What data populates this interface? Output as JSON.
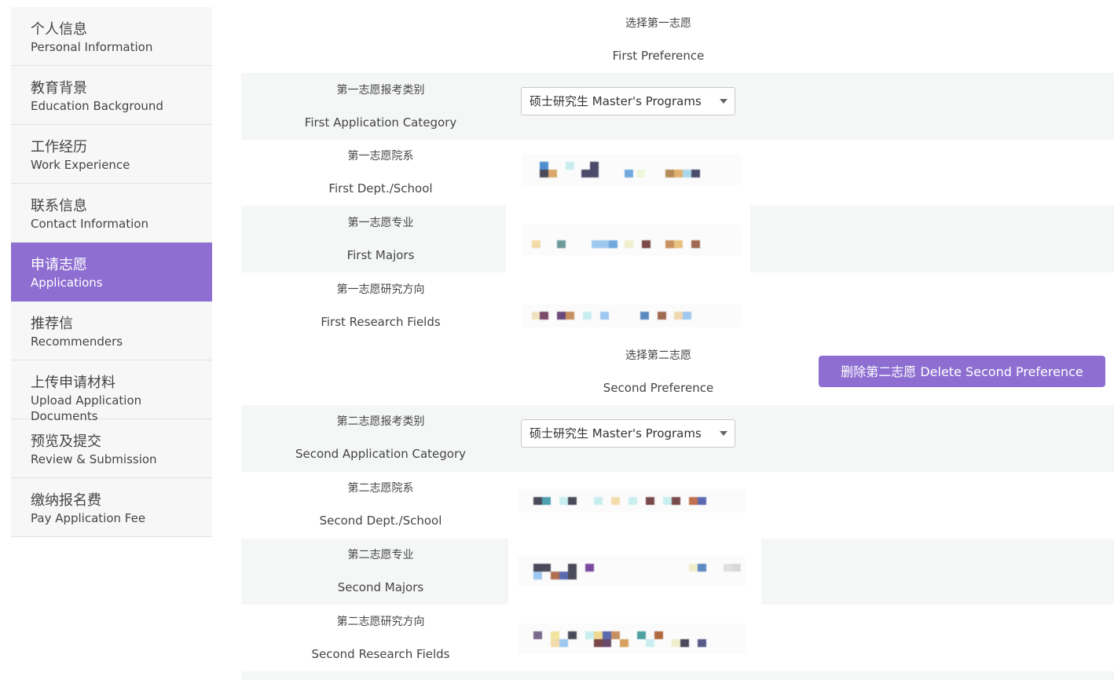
{
  "sidebar": {
    "items": [
      {
        "zh": "个人信息",
        "en": "Personal Information"
      },
      {
        "zh": "教育背景",
        "en": "Education Background"
      },
      {
        "zh": "工作经历",
        "en": "Work Experience"
      },
      {
        "zh": "联系信息",
        "en": "Contact Information"
      },
      {
        "zh": "申请志愿",
        "en": "Applications"
      },
      {
        "zh": "推荐信",
        "en": "Recommenders"
      },
      {
        "zh": "上传申请材料",
        "en": "Upload Application Documents"
      },
      {
        "zh": "预览及提交",
        "en": "Review & Submission"
      },
      {
        "zh": "缴纳报名费",
        "en": "Pay Application Fee"
      }
    ],
    "active_index": 4
  },
  "first": {
    "heading_zh": "选择第一志愿",
    "heading_en": "First Preference",
    "category_zh": "第一志愿报考类别",
    "category_en": "First Application Category",
    "category_value": "硕士研究生 Master's Programs",
    "dept_zh": "第一志愿院系",
    "dept_en": "First Dept./School",
    "major_zh": "第一志愿专业",
    "major_en": "First Majors",
    "field_zh": "第一志愿研究方向",
    "field_en": "First Research Fields"
  },
  "second": {
    "heading_zh": "选择第二志愿",
    "heading_en": "Second Preference",
    "delete_label": "删除第二志愿 Delete Second Preference",
    "category_zh": "第二志愿报考类别",
    "category_en": "Second Application Category",
    "category_value": "硕士研究生 Master's Programs",
    "dept_zh": "第二志愿院系",
    "dept_en": "Second Dept./School",
    "major_zh": "第二志愿专业",
    "major_en": "Second Majors",
    "field_zh": "第二志愿研究方向",
    "field_en": "Second Research Fields"
  },
  "colors": {
    "accent": "#8e6fd1",
    "row_shade": "#f5f7f6",
    "sidebar_bg": "#f7f7f7"
  }
}
